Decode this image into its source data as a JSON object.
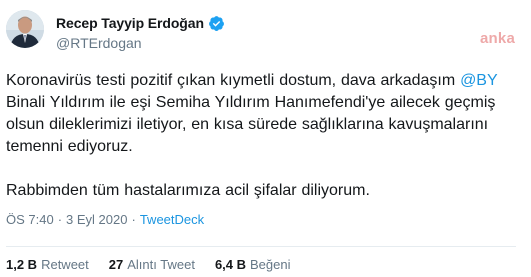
{
  "author": {
    "display_name": "Recep Tayyip Erdoğan",
    "handle": "@RTErdogan",
    "verified_icon": "verified-badge-icon"
  },
  "watermark": "anka",
  "tweet": {
    "p1_before": "Koronavirüs testi pozitif çıkan kıymetli dostum, dava arkadaşım ",
    "mention": "@BY",
    "p1_after": " Binali Yıldırım ile eşi Semiha Yıldırım Hanımefendi'ye ailecek geçmiş olsun dileklerimizi iletiyor, en kısa sürede sağlıklarına kavuşmalarını temenni ediyoruz.",
    "p2": "Rabbimden tüm hastalarımıza acil şifalar diliyorum."
  },
  "meta": {
    "time": "ÖS 7:40",
    "separator": "·",
    "date": "3 Eyl 2020",
    "source": "TweetDeck"
  },
  "stats": {
    "retweets_count": "1,2 B",
    "retweets_label": "Retweet",
    "quotes_count": "27",
    "quotes_label": "Alıntı Tweet",
    "likes_count": "6,4 B",
    "likes_label": "Beğeni"
  },
  "colors": {
    "link": "#1b95e0",
    "text": "#14171a",
    "muted": "#657786",
    "watermark": "#ec9b9b"
  }
}
